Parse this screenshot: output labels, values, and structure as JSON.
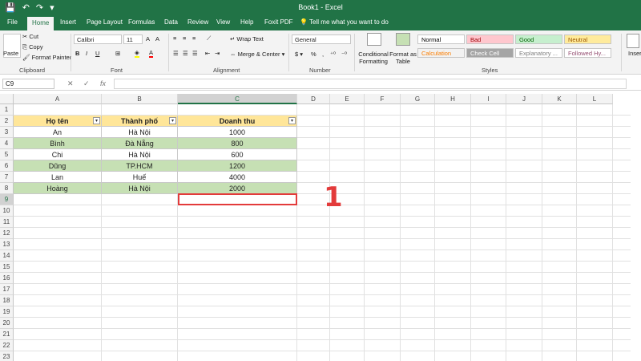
{
  "window": {
    "title": "Book1 - Excel"
  },
  "tabs": [
    "File",
    "Home",
    "Insert",
    "Page Layout",
    "Formulas",
    "Data",
    "Review",
    "View",
    "Help",
    "Foxit PDF"
  ],
  "active_tab": "Home",
  "tell_me": "Tell me what you want to do",
  "ribbon": {
    "clipboard": {
      "label": "Clipboard",
      "paste": "Paste",
      "cut": "Cut",
      "copy": "Copy",
      "format_painter": "Format Painter"
    },
    "font": {
      "label": "Font",
      "name": "Calibri",
      "size": "11"
    },
    "alignment": {
      "label": "Alignment",
      "wrap_text": "Wrap Text",
      "merge_center": "Merge & Center"
    },
    "number": {
      "label": "Number",
      "format": "General"
    },
    "styles": {
      "label": "Styles",
      "conditional": "Conditional Formatting",
      "format_as_table": "Format as Table",
      "cells": [
        {
          "name": "Normal",
          "bg": "#ffffff",
          "color": "#000000"
        },
        {
          "name": "Bad",
          "bg": "#ffc7ce",
          "color": "#9c0006"
        },
        {
          "name": "Good",
          "bg": "#c6efce",
          "color": "#006100"
        },
        {
          "name": "Neutral",
          "bg": "#ffeb9c",
          "color": "#9c5700"
        },
        {
          "name": "Calculation",
          "bg": "#f2f2f2",
          "color": "#fa7d00"
        },
        {
          "name": "Check Cell",
          "bg": "#a5a5a5",
          "color": "#ffffff"
        },
        {
          "name": "Explanatory ...",
          "bg": "#ffffff",
          "color": "#7f7f7f"
        },
        {
          "name": "Followed Hy...",
          "bg": "#ffffff",
          "color": "#954f72"
        }
      ]
    },
    "insert": "Insert"
  },
  "formula_bar": {
    "name_box": "C9",
    "fx": "fx",
    "value": ""
  },
  "columns": [
    "A",
    "B",
    "C",
    "D",
    "E",
    "F",
    "G",
    "H",
    "I",
    "J",
    "K",
    "L"
  ],
  "rows": [
    "1",
    "2",
    "3",
    "4",
    "5",
    "6",
    "7",
    "8",
    "9",
    "10",
    "11",
    "12",
    "13",
    "14",
    "15",
    "16",
    "17",
    "18",
    "19",
    "20",
    "21",
    "22",
    "23"
  ],
  "selected_cell": "C9",
  "table": {
    "headers": [
      "Họ tên",
      "Thành phố",
      "Doanh thu"
    ],
    "rows": [
      [
        "An",
        "Hà Nội",
        "1000"
      ],
      [
        "Bình",
        "Đà Nẵng",
        "800"
      ],
      [
        "Chi",
        "Hà Nội",
        "600"
      ],
      [
        "Dũng",
        "TP.HCM",
        "1200"
      ],
      [
        "Lan",
        "Huế",
        "4000"
      ],
      [
        "Hoàng",
        "Hà Nội",
        "2000"
      ]
    ]
  },
  "annotation": {
    "label": "1",
    "color": "#e33b3b"
  },
  "colors": {
    "brand": "#217346",
    "header_fill": "#ffe699",
    "band_fill": "#c6e0b4"
  }
}
